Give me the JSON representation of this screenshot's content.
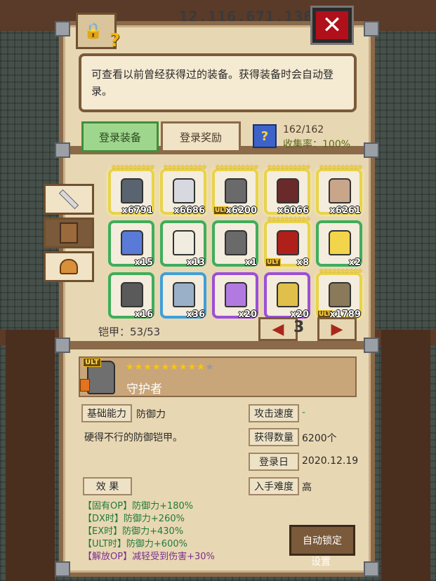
{
  "top_bar": {
    "gold": "12,116,671,136"
  },
  "description": "可查看以前曾经获得过的装备。获得装备时会自动登录。",
  "tabs": {
    "register_equipment": "登录装备",
    "register_reward": "登录奖励"
  },
  "collection": {
    "count": "162/162",
    "rate": "收集率：100%"
  },
  "armor_count": "铠甲：53/53",
  "page": "3",
  "items": [
    {
      "count": "x6791",
      "rarity": "yellow",
      "ult": false,
      "color": "#5a6470"
    },
    {
      "count": "x6686",
      "rarity": "yellow",
      "ult": false,
      "color": "#d8d8e0"
    },
    {
      "count": "x6200",
      "rarity": "yellow",
      "ult": true,
      "color": "#6a6a6a"
    },
    {
      "count": "x6066",
      "rarity": "yellow",
      "ult": false,
      "color": "#6a2a2a"
    },
    {
      "count": "x6261",
      "rarity": "yellow",
      "ult": false,
      "color": "#c9a58a"
    },
    {
      "count": "x15",
      "rarity": "green",
      "ult": false,
      "color": "#5a7ad8"
    },
    {
      "count": "x13",
      "rarity": "green",
      "ult": false,
      "color": "#f0ece0"
    },
    {
      "count": "x1",
      "rarity": "green",
      "ult": false,
      "color": "#6a6a6a"
    },
    {
      "count": "x8",
      "rarity": "yellow",
      "ult": true,
      "color": "#b0201a"
    },
    {
      "count": "x2",
      "rarity": "green",
      "ult": false,
      "color": "#f2d54a"
    },
    {
      "count": "x16",
      "rarity": "green",
      "ult": false,
      "color": "#5a5a5a"
    },
    {
      "count": "x36",
      "rarity": "blue",
      "ult": false,
      "color": "#9ab0c8"
    },
    {
      "count": "x20",
      "rarity": "purple",
      "ult": false,
      "color": "#b27ae0"
    },
    {
      "count": "x20",
      "rarity": "purple",
      "ult": false,
      "color": "#e0c04a"
    },
    {
      "count": "x1789",
      "rarity": "yellow",
      "ult": true,
      "color": "#8a7a5a"
    }
  ],
  "detail": {
    "ult_badge": "ULT",
    "name": "守护者",
    "star_count": 10,
    "stars_filled": 9,
    "base_ability_label": "基础能力",
    "base_ability_value": "防御力",
    "attack_speed_label": "攻击速度",
    "attack_speed_value": "-",
    "flavor": "硬得不行的防御铠甲。",
    "obtained_label": "获得数量",
    "obtained_value": "6200个",
    "register_date_label": "登录日",
    "register_date_value": "2020.12.19",
    "difficulty_label": "入手难度",
    "difficulty_value": "高",
    "effect_label": "效 果",
    "effects": [
      "【固有OP】防御力+180%",
      "【DX时】防御力+260%",
      "【EX时】防御力+430%",
      "【ULT时】防御力+600%",
      "【解放OP】减轻受到伤害+30%"
    ]
  },
  "auto_lock": {
    "line1": "自动锁定",
    "line2": "设置"
  }
}
